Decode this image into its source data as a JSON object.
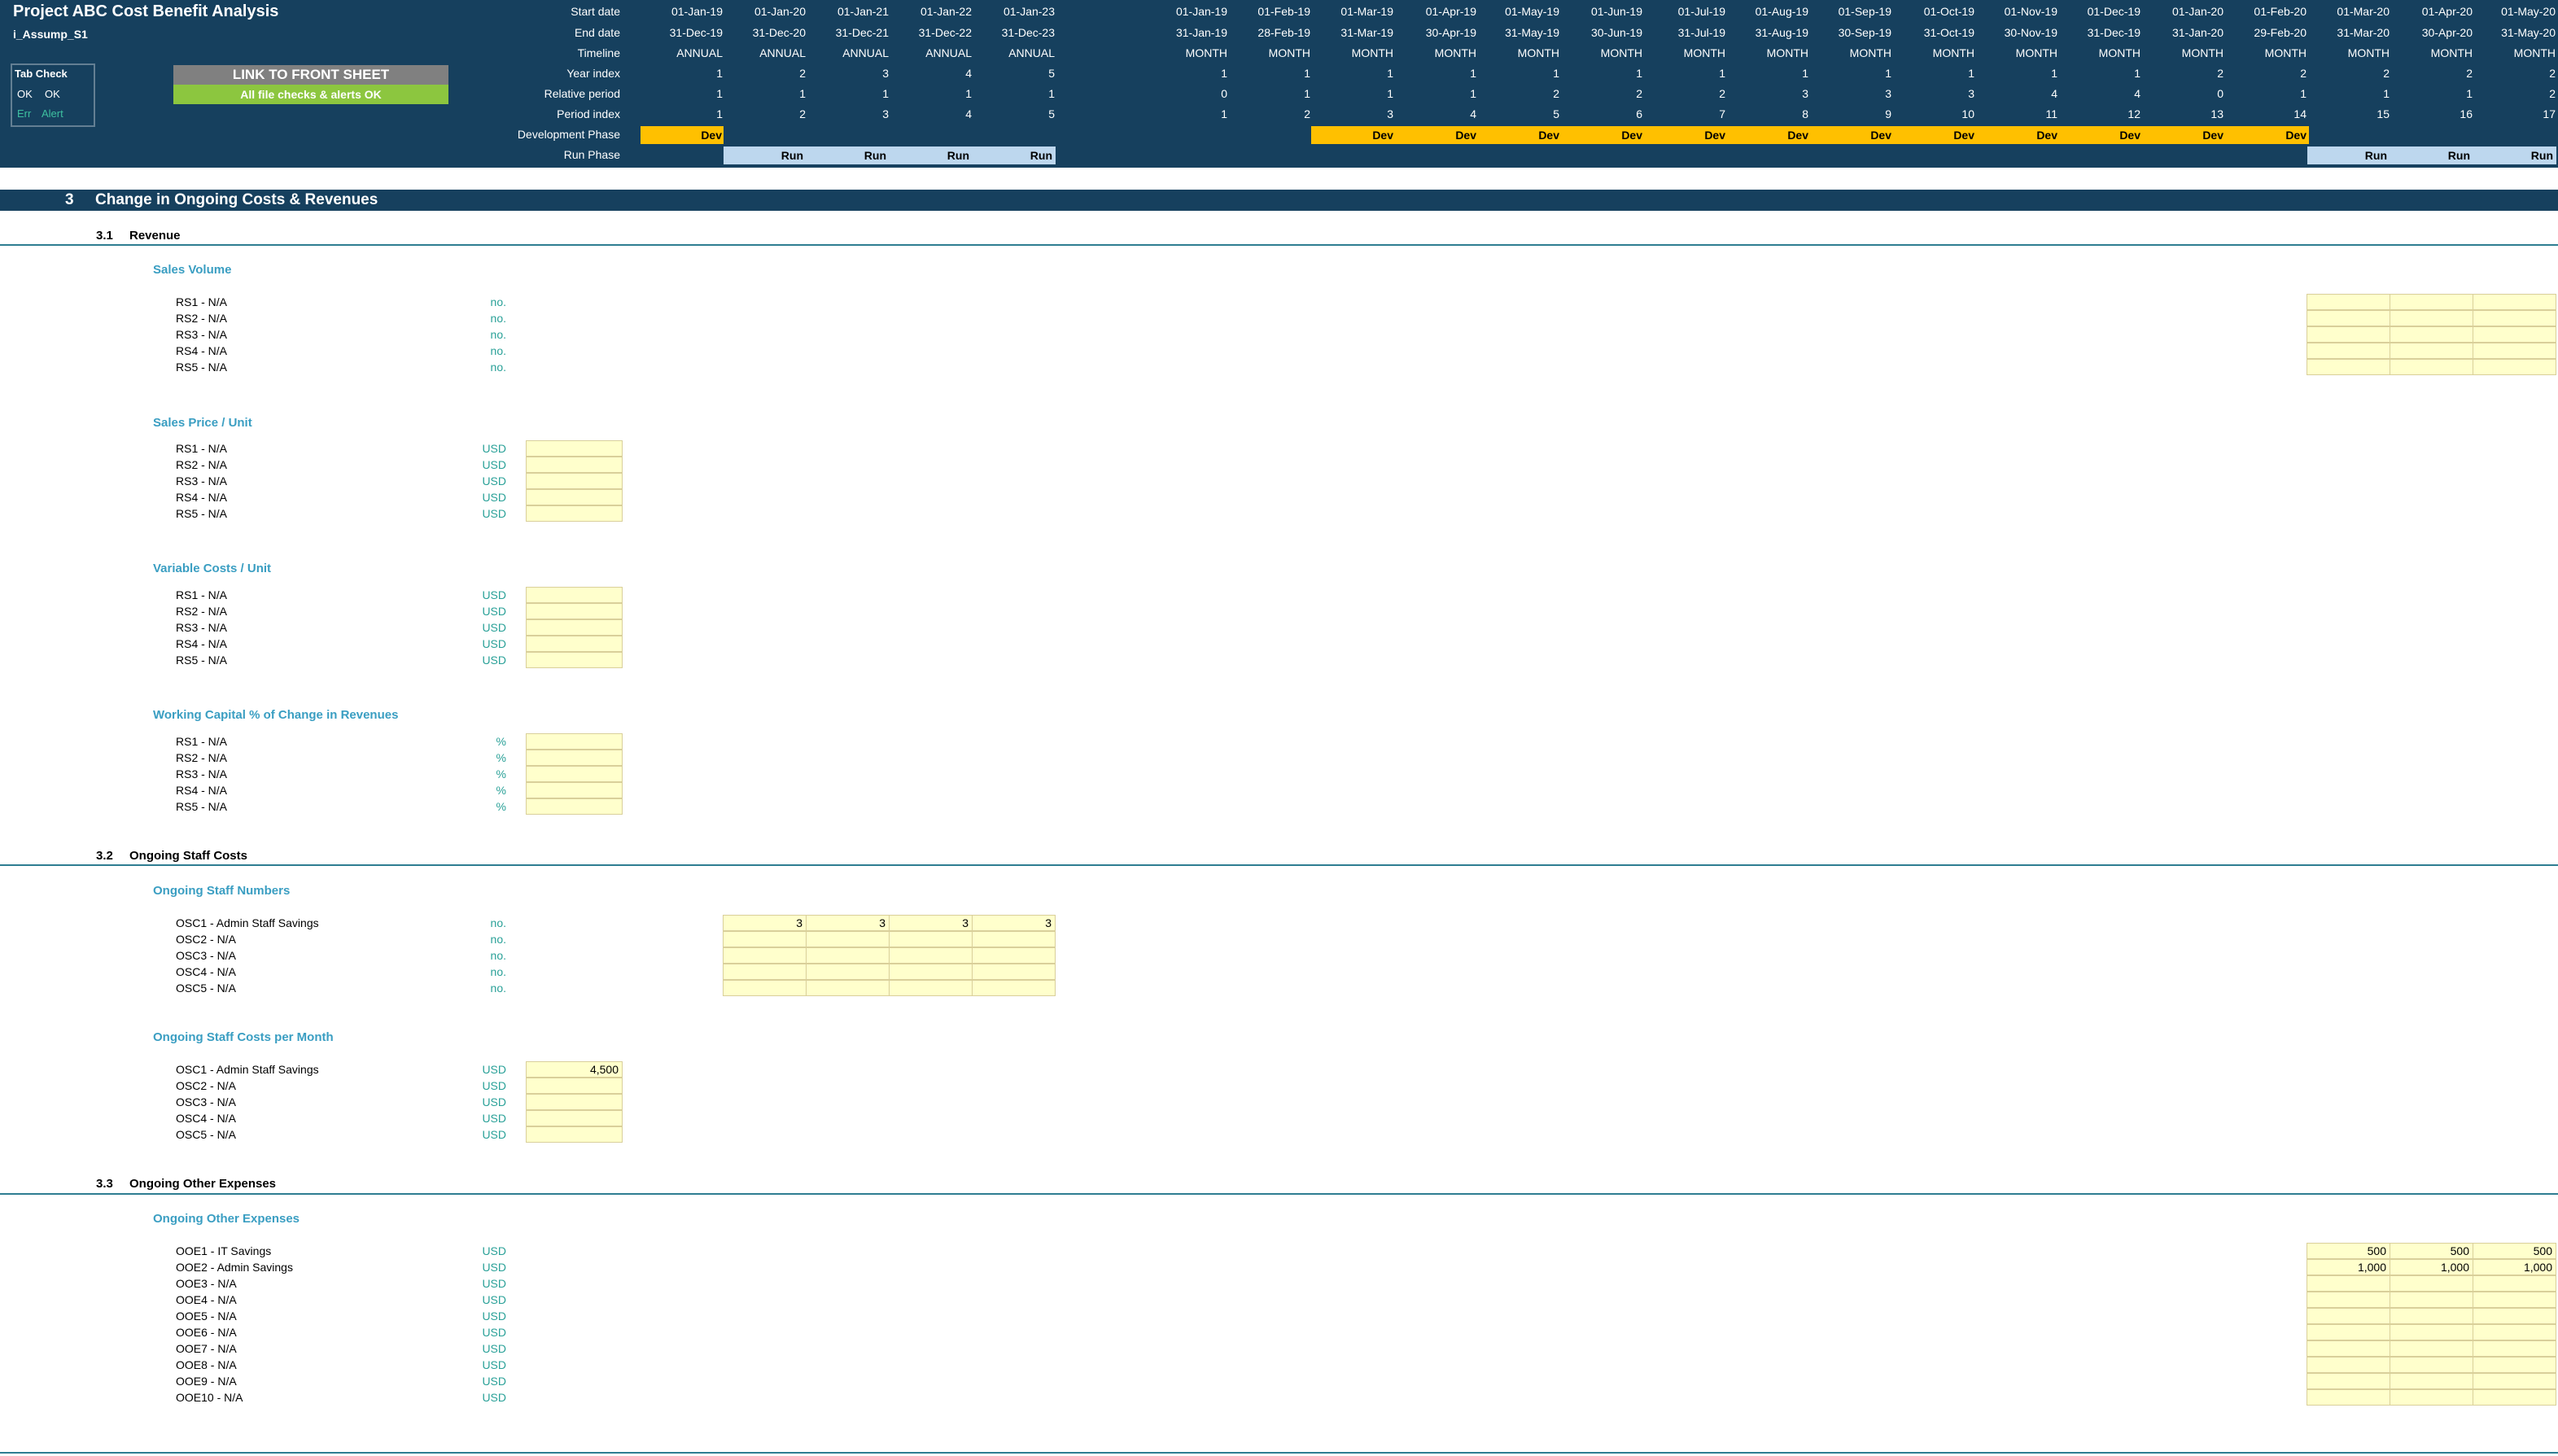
{
  "header": {
    "title": "Project ABC Cost Benefit Analysis",
    "sheet": "i_Assump_S1",
    "labels": {
      "start": "Start date",
      "end": "End date",
      "timeline": "Timeline",
      "year_index": "Year index",
      "relative": "Relative period",
      "period_index": "Period index",
      "dev_phase": "Development Phase",
      "run_phase": "Run Phase"
    },
    "tab_check": {
      "title": "Tab Check",
      "ok1": "OK",
      "ok2": "OK",
      "err": "Err",
      "alert": "Alert"
    },
    "link_button": "LINK TO FRONT SHEET",
    "checks_status": "All file checks & alerts OK",
    "dev_label": "Dev",
    "run_label": "Run",
    "annual": {
      "start": [
        "01-Jan-19",
        "01-Jan-20",
        "01-Jan-21",
        "01-Jan-22",
        "01-Jan-23"
      ],
      "end": [
        "31-Dec-19",
        "31-Dec-20",
        "31-Dec-21",
        "31-Dec-22",
        "31-Dec-23"
      ],
      "timeline": [
        "ANNUAL",
        "ANNUAL",
        "ANNUAL",
        "ANNUAL",
        "ANNUAL"
      ],
      "year_index": [
        "1",
        "2",
        "3",
        "4",
        "5"
      ],
      "relative": [
        "1",
        "1",
        "1",
        "1",
        "1"
      ],
      "period_index": [
        "1",
        "2",
        "3",
        "4",
        "5"
      ]
    },
    "monthly": {
      "start": [
        "01-Jan-19",
        "01-Feb-19",
        "01-Mar-19",
        "01-Apr-19",
        "01-May-19",
        "01-Jun-19",
        "01-Jul-19",
        "01-Aug-19",
        "01-Sep-19",
        "01-Oct-19",
        "01-Nov-19",
        "01-Dec-19",
        "01-Jan-20",
        "01-Feb-20",
        "01-Mar-20",
        "01-Apr-20",
        "01-May-20"
      ],
      "end": [
        "31-Jan-19",
        "28-Feb-19",
        "31-Mar-19",
        "30-Apr-19",
        "31-May-19",
        "30-Jun-19",
        "31-Jul-19",
        "31-Aug-19",
        "30-Sep-19",
        "31-Oct-19",
        "30-Nov-19",
        "31-Dec-19",
        "31-Jan-20",
        "29-Feb-20",
        "31-Mar-20",
        "30-Apr-20",
        "31-May-20"
      ],
      "timeline": [
        "MONTH",
        "MONTH",
        "MONTH",
        "MONTH",
        "MONTH",
        "MONTH",
        "MONTH",
        "MONTH",
        "MONTH",
        "MONTH",
        "MONTH",
        "MONTH",
        "MONTH",
        "MONTH",
        "MONTH",
        "MONTH",
        "MONTH"
      ],
      "year_index": [
        "1",
        "1",
        "1",
        "1",
        "1",
        "1",
        "1",
        "1",
        "1",
        "1",
        "1",
        "1",
        "2",
        "2",
        "2",
        "2",
        "2"
      ],
      "relative": [
        "0",
        "1",
        "1",
        "1",
        "2",
        "2",
        "2",
        "3",
        "3",
        "3",
        "4",
        "4",
        "0",
        "1",
        "1",
        "1",
        "2"
      ],
      "period_index": [
        "1",
        "2",
        "3",
        "4",
        "5",
        "6",
        "7",
        "8",
        "9",
        "10",
        "11",
        "12",
        "13",
        "14",
        "15",
        "16",
        "17"
      ]
    }
  },
  "section": {
    "number": "3",
    "title": "Change in Ongoing Costs & Revenues"
  },
  "sub_revenue": {
    "number": "3.1",
    "title": "Revenue"
  },
  "sub_staff": {
    "number": "3.2",
    "title": "Ongoing Staff Costs"
  },
  "sub_other": {
    "number": "3.3",
    "title": "Ongoing Other Expenses"
  },
  "groups": {
    "sales_volume": {
      "title": "Sales Volume",
      "unit": "no.",
      "rows": [
        "RS1 - N/A",
        "RS2 - N/A",
        "RS3 - N/A",
        "RS4 - N/A",
        "RS5 - N/A"
      ]
    },
    "sales_price": {
      "title": "Sales Price / Unit",
      "unit": "USD",
      "rows": [
        "RS1 - N/A",
        "RS2 - N/A",
        "RS3 - N/A",
        "RS4 - N/A",
        "RS5 - N/A"
      ]
    },
    "variable_costs": {
      "title": "Variable Costs / Unit",
      "unit": "USD",
      "rows": [
        "RS1 - N/A",
        "RS2 - N/A",
        "RS3 - N/A",
        "RS4 - N/A",
        "RS5 - N/A"
      ]
    },
    "working_capital": {
      "title": "Working Capital % of Change in Revenues",
      "unit": "%",
      "rows": [
        "RS1 - N/A",
        "RS2 - N/A",
        "RS3 - N/A",
        "RS4 - N/A",
        "RS5 - N/A"
      ]
    },
    "staff_numbers": {
      "title": "Ongoing Staff Numbers",
      "unit": "no.",
      "rows": [
        "OSC1 - Admin Staff Savings",
        "OSC2 - N/A",
        "OSC3 - N/A",
        "OSC4 - N/A",
        "OSC5 - N/A"
      ],
      "values": [
        [
          "3",
          "3",
          "3",
          "3"
        ],
        [
          "",
          "",
          "",
          ""
        ],
        [
          "",
          "",
          "",
          ""
        ],
        [
          "",
          "",
          "",
          ""
        ],
        [
          "",
          "",
          "",
          ""
        ]
      ]
    },
    "staff_costs": {
      "title": "Ongoing Staff Costs per Month",
      "unit": "USD",
      "rows": [
        "OSC1 - Admin Staff Savings",
        "OSC2 - N/A",
        "OSC3 - N/A",
        "OSC4 - N/A",
        "OSC5 - N/A"
      ],
      "values": [
        "4,500",
        "",
        "",
        "",
        ""
      ]
    },
    "other_expenses": {
      "title": "Ongoing Other Expenses",
      "unit": "USD",
      "rows": [
        "OOE1 - IT Savings",
        "OOE2 - Admin Savings",
        "OOE3 - N/A",
        "OOE4 - N/A",
        "OOE5 - N/A",
        "OOE6 - N/A",
        "OOE7 - N/A",
        "OOE8 - N/A",
        "OOE9 - N/A",
        "OOE10 - N/A"
      ],
      "values": [
        [
          "500",
          "500",
          "500"
        ],
        [
          "1,000",
          "1,000",
          "1,000"
        ],
        [
          "",
          "",
          ""
        ],
        [
          "",
          "",
          ""
        ],
        [
          "",
          "",
          ""
        ],
        [
          "",
          "",
          ""
        ],
        [
          "",
          "",
          ""
        ],
        [
          "",
          "",
          ""
        ],
        [
          "",
          "",
          ""
        ],
        [
          "",
          "",
          ""
        ]
      ]
    }
  }
}
